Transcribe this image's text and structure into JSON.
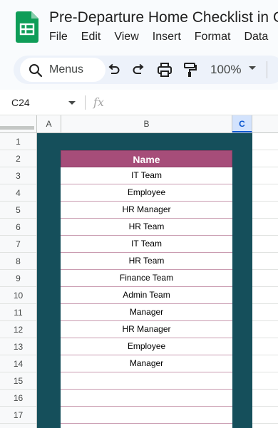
{
  "document": {
    "title": "Pre-Departure Home Checklist in G"
  },
  "menu": [
    "File",
    "Edit",
    "View",
    "Insert",
    "Format",
    "Data"
  ],
  "toolbar": {
    "search_label": "Menus",
    "zoom": "100%"
  },
  "formula_bar": {
    "cell_ref": "C24",
    "fx_label": "fx",
    "value": ""
  },
  "columns": [
    "A",
    "B",
    "C"
  ],
  "active_column": "C",
  "rows": [
    "1",
    "2",
    "3",
    "4",
    "5",
    "6",
    "7",
    "8",
    "9",
    "10",
    "11",
    "12",
    "13",
    "14",
    "15",
    "16",
    "17"
  ],
  "table": {
    "header": "Name",
    "values": [
      "IT Team",
      "Employee",
      "HR Manager",
      "HR Team",
      "IT Team",
      "HR Team",
      "Finance Team",
      "Admin Team",
      "Manager",
      "HR Manager",
      "Employee",
      "Manager",
      "",
      "",
      "",
      ""
    ]
  },
  "colors": {
    "header_fill": "#a64d79",
    "background_fill": "#154f5b",
    "sheets_green": "#0f9d58"
  },
  "icons": [
    "sheets-logo-icon",
    "search-icon",
    "undo-icon",
    "redo-icon",
    "print-icon",
    "paint-format-icon",
    "chevron-down-icon",
    "fx-icon"
  ]
}
